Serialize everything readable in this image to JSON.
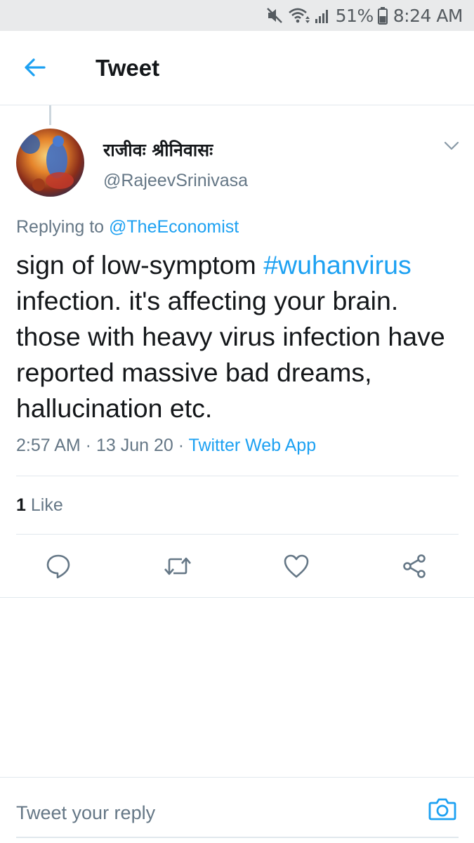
{
  "status_bar": {
    "battery_percent": "51%",
    "time": "8:24 AM",
    "icons": [
      "mute-icon",
      "wifi-icon",
      "signal-icon",
      "battery-icon"
    ]
  },
  "header": {
    "title": "Tweet",
    "back_icon": "arrow-left-icon"
  },
  "tweet": {
    "display_name": "राजीवः श्रीनिवासः",
    "handle": "@RajeevSrinivasa",
    "replying_prefix": "Replying to",
    "replying_to": "@TheEconomist",
    "text_before": "sign of low-symptom ",
    "hashtag": "#wuhanvirus",
    "text_after": " infection. it's affecting your brain. those with heavy virus infection have reported massive bad dreams, hallucination etc.",
    "time": "2:57 AM",
    "separator": " · ",
    "date": "13 Jun 20",
    "source": "Twitter Web App",
    "likes_count": "1",
    "likes_label": "Like"
  },
  "actions": [
    "reply-icon",
    "retweet-icon",
    "like-icon",
    "share-icon"
  ],
  "reply_bar": {
    "placeholder": "Tweet your reply",
    "camera_icon": "camera-icon"
  },
  "colors": {
    "accent": "#1da1f2",
    "secondary_text": "#657786",
    "primary_text": "#14171a",
    "status_bar_bg": "#e9eaeb"
  }
}
